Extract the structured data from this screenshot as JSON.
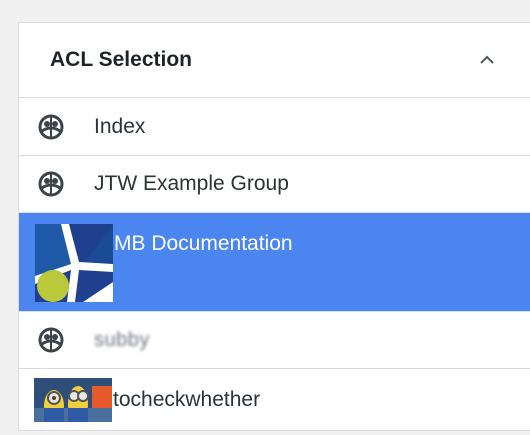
{
  "panel": {
    "title": "ACL Selection",
    "collapse_icon": "chevron-up-icon"
  },
  "items": [
    {
      "label": "Index",
      "icon": "group-globe-icon",
      "selected": false
    },
    {
      "label": "JTW Example Group",
      "icon": "group-globe-icon",
      "selected": false
    },
    {
      "label": "MB Documentation",
      "icon": "blue-white-logo-thumbnail",
      "selected": true
    },
    {
      "label": "subby",
      "icon": "group-globe-icon",
      "selected": false
    },
    {
      "label": "tocheckwhether",
      "icon": "minions-thumbnail",
      "selected": false
    }
  ],
  "colors": {
    "selected_bg": "#4a85f0",
    "border": "#dcdcde",
    "text": "#2c3338"
  }
}
